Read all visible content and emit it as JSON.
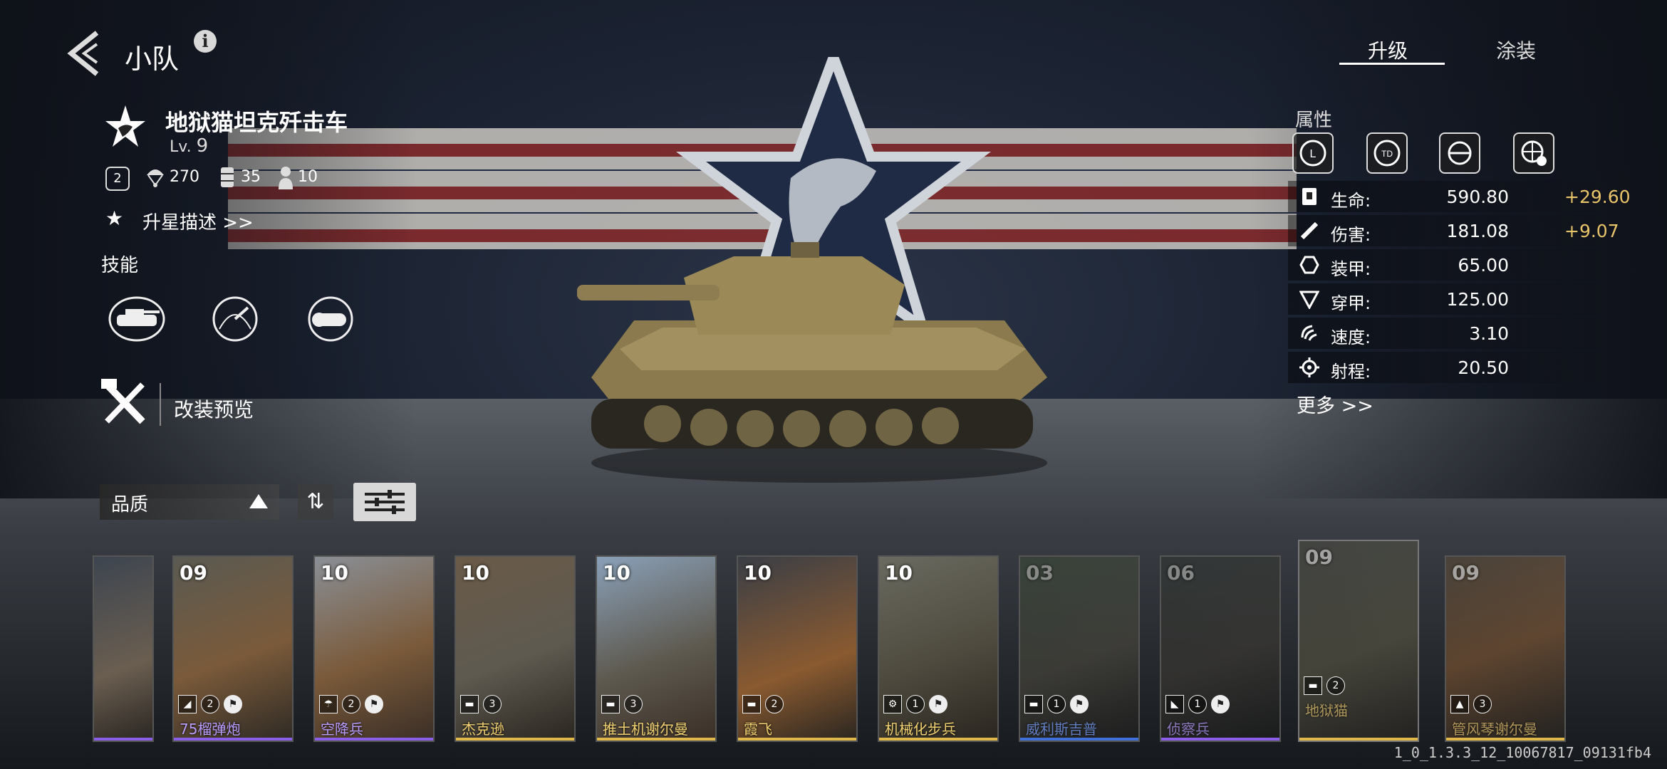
{
  "header": {
    "title": "小队",
    "info_icon": "i"
  },
  "tabs": [
    {
      "label": "升级",
      "active": true
    },
    {
      "label": "涂装",
      "active": false
    }
  ],
  "unit": {
    "name": "地狱猫坦克歼击车",
    "level_prefix": "Lv.",
    "level": "9",
    "star_badge": "2",
    "parachute_value": "270",
    "fuel_value": "35",
    "crew_value": "10",
    "upgrade_desc_label": "升星描述 >>"
  },
  "skills": {
    "label": "技能",
    "icons": [
      "tank-skill-icon",
      "gauge-skill-icon",
      "armor-shell-skill-icon"
    ]
  },
  "modify_preview": {
    "label": "改装预览"
  },
  "sort": {
    "label": "品质",
    "order_icon": "⇅"
  },
  "attributes": {
    "label": "属性",
    "type_icons": [
      "light-tank-icon",
      "tank-destroyer-icon",
      "target-icon",
      "globe-gear-icon"
    ],
    "rows": [
      {
        "name": "生命:",
        "value": "590.80",
        "bonus": "+29.60",
        "icon": "health-icon"
      },
      {
        "name": "伤害:",
        "value": "181.08",
        "bonus": "+9.07",
        "icon": "damage-icon"
      },
      {
        "name": "装甲:",
        "value": "65.00",
        "bonus": "",
        "icon": "armor-icon"
      },
      {
        "name": "穿甲:",
        "value": "125.00",
        "bonus": "",
        "icon": "penetration-icon"
      },
      {
        "name": "速度:",
        "value": "3.10",
        "bonus": "",
        "icon": "speed-icon"
      },
      {
        "name": "射程:",
        "value": "20.50",
        "bonus": "",
        "icon": "range-icon"
      }
    ],
    "more_label": "更多 >>"
  },
  "cards": [
    {
      "level": "",
      "name": "",
      "stars": "",
      "rarity_color": "#8a5ee8"
    },
    {
      "level": "09",
      "name": "75榴弹炮",
      "stars": "2",
      "rarity_color": "#8a5ee8"
    },
    {
      "level": "10",
      "name": "空降兵",
      "stars": "2",
      "rarity_color": "#8a5ee8"
    },
    {
      "level": "10",
      "name": "杰克逊",
      "stars": "3",
      "rarity_color": "#e0b84a"
    },
    {
      "level": "10",
      "name": "推土机谢尔曼",
      "stars": "3",
      "rarity_color": "#e0b84a"
    },
    {
      "level": "10",
      "name": "霞飞",
      "stars": "2",
      "rarity_color": "#e0b84a"
    },
    {
      "level": "10",
      "name": "机械化步兵",
      "stars": "1",
      "rarity_color": "#e0b84a"
    },
    {
      "level": "03",
      "name": "威利斯吉普",
      "stars": "1",
      "rarity_color": "#3f6fd8"
    },
    {
      "level": "06",
      "name": "侦察兵",
      "stars": "1",
      "rarity_color": "#8a5ee8"
    },
    {
      "level": "09",
      "name": "地狱猫",
      "stars": "2",
      "rarity_color": "#e0b84a"
    },
    {
      "level": "09",
      "name": "管风琴谢尔曼",
      "stars": "3",
      "rarity_color": "#e0b84a"
    }
  ],
  "version": "1_0_1.3.3_12_10067817_09131fb4"
}
